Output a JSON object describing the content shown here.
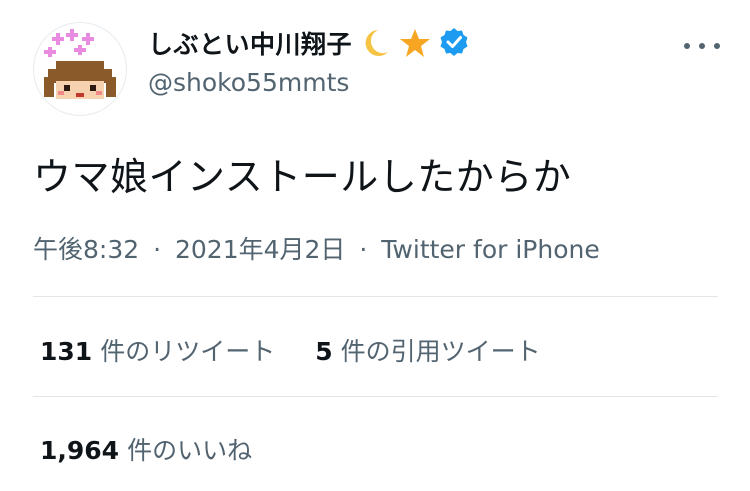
{
  "user": {
    "display_name": "しぶとい中川翔子",
    "emoji_moon": "🌙",
    "emoji_star": "⭐",
    "handle": "@shoko55mmts",
    "verified": true
  },
  "tweet": {
    "text": "ウマ娘インストールしたからか",
    "time": "午後8:32",
    "separator": "·",
    "date": "2021年4月2日",
    "source": "Twitter for iPhone"
  },
  "stats": {
    "retweets": {
      "count": "131",
      "label": "件のリツイート"
    },
    "quotes": {
      "count": "5",
      "label": "件の引用ツイート"
    },
    "likes": {
      "count": "1,964",
      "label": "件のいいね"
    }
  },
  "colors": {
    "verified_blue": "#1d9bf0",
    "muted_text": "#536471",
    "divider": "#e1e6ea"
  }
}
